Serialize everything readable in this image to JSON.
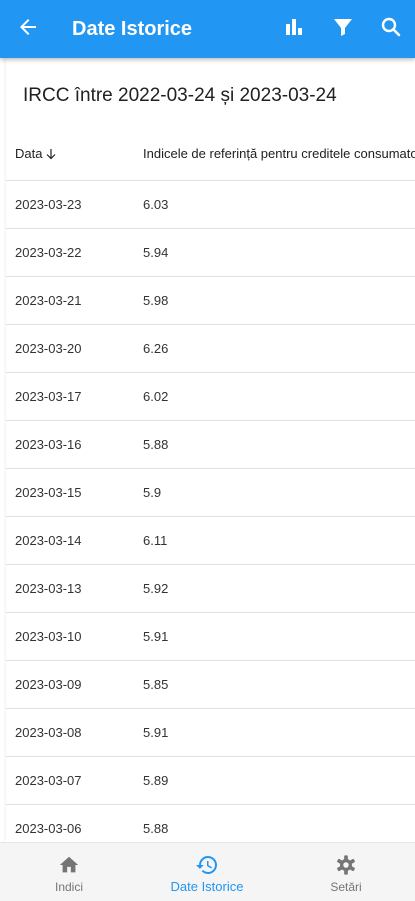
{
  "appbar": {
    "title": "Date Istorice",
    "icons": {
      "back": "arrow-left-icon",
      "chart": "bar-chart-icon",
      "filter": "filter-icon",
      "search": "search-icon"
    }
  },
  "page": {
    "heading": "IRCC între 2022-03-24 și 2023-03-24"
  },
  "table": {
    "columns": {
      "date": "Data",
      "value": "Indicele de referință pentru creditele consumatorilor"
    },
    "sort": "date-descending",
    "rows": [
      {
        "date": "2023-03-23",
        "value": "6.03"
      },
      {
        "date": "2023-03-22",
        "value": "5.94"
      },
      {
        "date": "2023-03-21",
        "value": "5.98"
      },
      {
        "date": "2023-03-20",
        "value": "6.26"
      },
      {
        "date": "2023-03-17",
        "value": "6.02"
      },
      {
        "date": "2023-03-16",
        "value": "5.88"
      },
      {
        "date": "2023-03-15",
        "value": "5.9"
      },
      {
        "date": "2023-03-14",
        "value": "6.11"
      },
      {
        "date": "2023-03-13",
        "value": "5.92"
      },
      {
        "date": "2023-03-10",
        "value": "5.91"
      },
      {
        "date": "2023-03-09",
        "value": "5.85"
      },
      {
        "date": "2023-03-08",
        "value": "5.91"
      },
      {
        "date": "2023-03-07",
        "value": "5.89"
      },
      {
        "date": "2023-03-06",
        "value": "5.88"
      }
    ]
  },
  "bottom_nav": {
    "items": [
      {
        "label": "Indici",
        "icon": "home-icon",
        "active": false
      },
      {
        "label": "Date Istorice",
        "icon": "history-icon",
        "active": true
      },
      {
        "label": "Setări",
        "icon": "settings-icon",
        "active": false
      }
    ]
  },
  "colors": {
    "primary": "#2196f3",
    "inactive": "#757575",
    "divider": "#e0e0e0"
  }
}
